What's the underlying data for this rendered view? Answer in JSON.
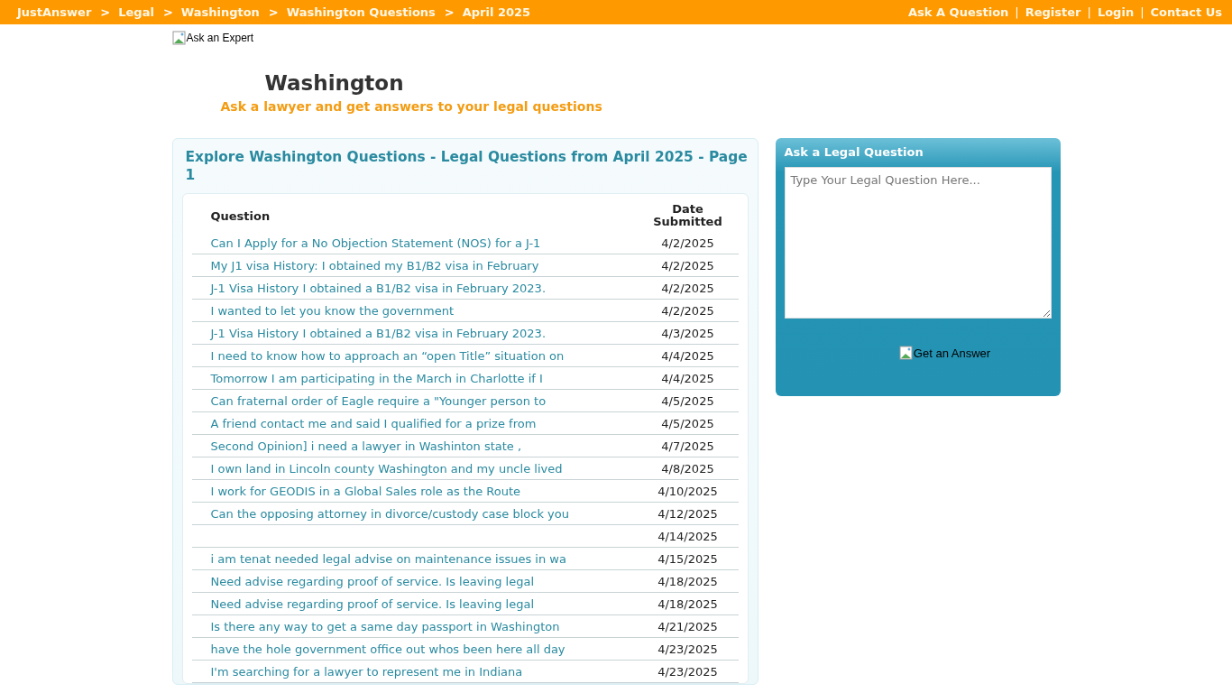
{
  "breadcrumb": [
    "JustAnswer",
    "Legal",
    "Washington",
    "Washington Questions",
    "April 2025"
  ],
  "breadcrumb_separator": ">",
  "top_links": [
    "Ask A Question",
    "Register",
    "Login",
    "Contact Us"
  ],
  "top_link_separator": "|",
  "logo_alt": "Ask an Expert",
  "page_title": "Washington",
  "tagline": "Ask a lawyer and get answers to your legal questions",
  "listing": {
    "title": "Explore Washington Questions - Legal Questions from April 2025 - Page 1",
    "columns": [
      "Question",
      "Date Submitted"
    ],
    "rows": [
      {
        "question": "Can I Apply for a No Objection Statement (NOS) for a J-1",
        "date": "4/2/2025"
      },
      {
        "question": "My J1 visa History: I obtained my B1/B2 visa in February",
        "date": "4/2/2025"
      },
      {
        "question": "J-1 Visa History I obtained a B1/B2 visa in February 2023.",
        "date": "4/2/2025"
      },
      {
        "question": "I wanted to let you know the government",
        "date": "4/2/2025"
      },
      {
        "question": "J-1 Visa History I obtained a B1/B2 visa in February 2023.",
        "date": "4/3/2025"
      },
      {
        "question": "I need to know how to approach an “open Title” situation on",
        "date": "4/4/2025"
      },
      {
        "question": "Tomorrow I am participating in the March in Charlotte if I",
        "date": "4/4/2025"
      },
      {
        "question": "Can fraternal order of Eagle require a \"Younger person to",
        "date": "4/5/2025"
      },
      {
        "question": "A friend contact me and said I qualified for a prize from",
        "date": "4/5/2025"
      },
      {
        "question": "Second Opinion] i need a lawyer in Washinton state ,",
        "date": "4/7/2025"
      },
      {
        "question": "I own land in Lincoln county Washington and my uncle lived",
        "date": "4/8/2025"
      },
      {
        "question": "I work for GEODIS in a Global Sales role as the Route",
        "date": "4/10/2025"
      },
      {
        "question": "Can the opposing attorney in divorce/custody case block you",
        "date": "4/12/2025"
      },
      {
        "date": "4/14/2025"
      },
      {
        "question": "i am tenat needed legal advise on maintenance issues in wa",
        "date": "4/15/2025"
      },
      {
        "question": "Need advise regarding proof of service. Is leaving legal",
        "date": "4/18/2025"
      },
      {
        "question": "Need advise regarding proof of service. Is leaving legal",
        "date": "4/18/2025"
      },
      {
        "question": "Is there any way to get a same day passport in Washington",
        "date": "4/21/2025"
      },
      {
        "question": "have the hole government office out whos been here all day",
        "date": "4/23/2025"
      },
      {
        "question": "I'm searching for a lawyer to represent me in Indiana",
        "date": "4/23/2025"
      }
    ]
  },
  "ask_panel": {
    "title": "Ask a Legal Question",
    "placeholder": "Type Your Legal Question Here...",
    "button_alt": "Get an Answer"
  }
}
